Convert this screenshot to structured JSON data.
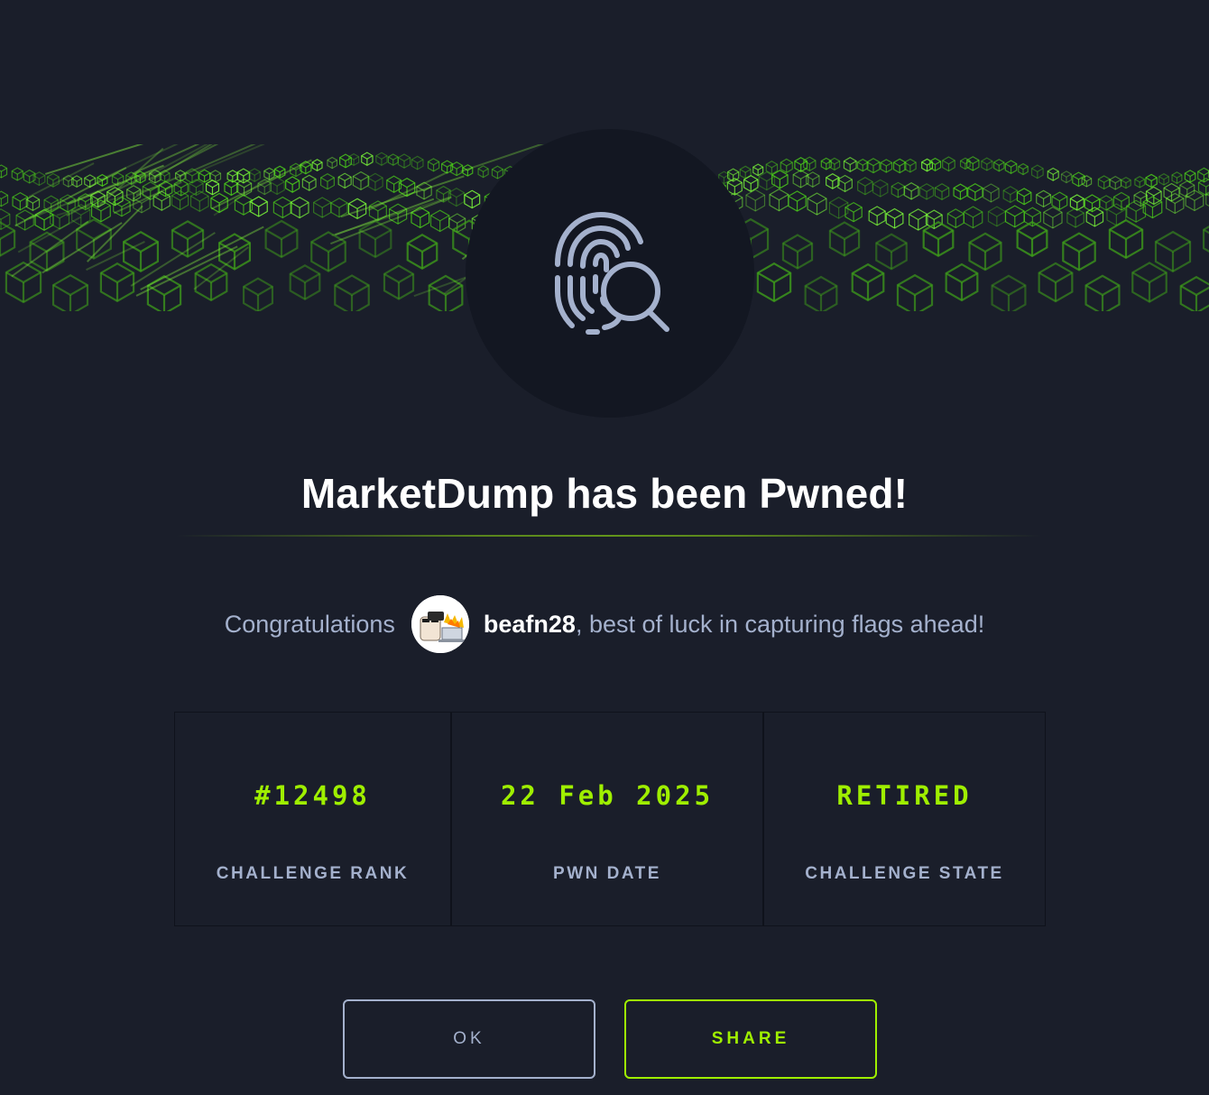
{
  "dialog": {
    "title": "MarketDump has been Pwned!",
    "badge_icon": "fingerprint-search-icon"
  },
  "congrats": {
    "prefix": "Congratulations",
    "avatar_icon": "user-avatar",
    "username": "beafn28",
    "suffix": ", best of luck in capturing flags ahead!"
  },
  "stats": [
    {
      "value": "#12498",
      "label": "CHALLENGE RANK"
    },
    {
      "value": "22 Feb 2025",
      "label": "PWN DATE"
    },
    {
      "value": "RETIRED",
      "label": "CHALLENGE STATE"
    }
  ],
  "buttons": {
    "ok_label": "OK",
    "share_label": "SHARE"
  },
  "colors": {
    "background": "#1a1e2a",
    "accent": "#9fef00",
    "muted": "#a4b1cd",
    "badge_bg": "#131722"
  }
}
